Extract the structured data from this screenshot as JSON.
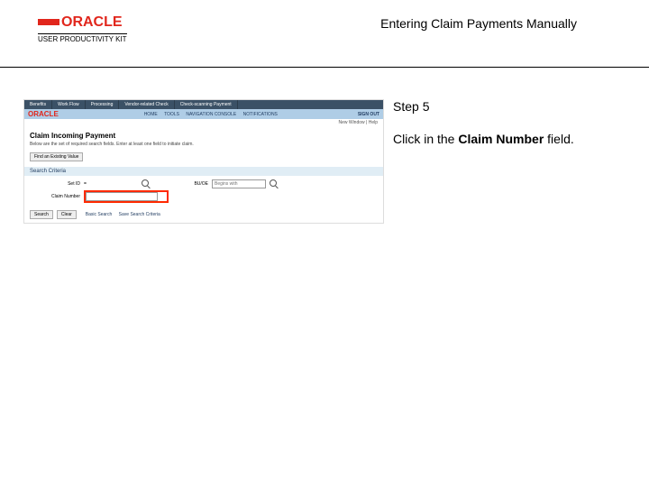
{
  "header": {
    "brand_word": "ORACLE",
    "brand_sub": "USER PRODUCTIVITY KIT",
    "doc_title": "Entering Claim Payments Manually"
  },
  "instruction": {
    "step_label": "Step 5",
    "line_prefix": "Click in the ",
    "line_bold": "Claim Number",
    "line_suffix": " field."
  },
  "shot": {
    "top_menu": [
      "Benefits",
      "Work Flow",
      "Processing",
      "Vendor-related Check",
      "Check-scanning Payment"
    ],
    "oracle_logo": "ORACLE",
    "tabs": [
      "HOME",
      "TOOLS",
      "NAVIGATION CONSOLE",
      "NOTIFICATIONS"
    ],
    "signout": "SIGN OUT",
    "substrip": "New Window | Help",
    "page_title": "Claim Incoming Payment",
    "page_desc": "Below are the set of required search fields. Enter at least one field to initiate claim.",
    "find_btn": "Find an Existing Value",
    "section_header": "Search Criteria",
    "labels": {
      "setid": "Set ID",
      "bu": "BU/OE",
      "claim": "Claim Number"
    },
    "values": {
      "setid": "",
      "bu_placeholder": "Begins with"
    },
    "footer": {
      "search_btn": "Search",
      "clear_btn": "Clear",
      "basic_link": "Basic Search",
      "save_link": "Save Search Criteria"
    }
  }
}
